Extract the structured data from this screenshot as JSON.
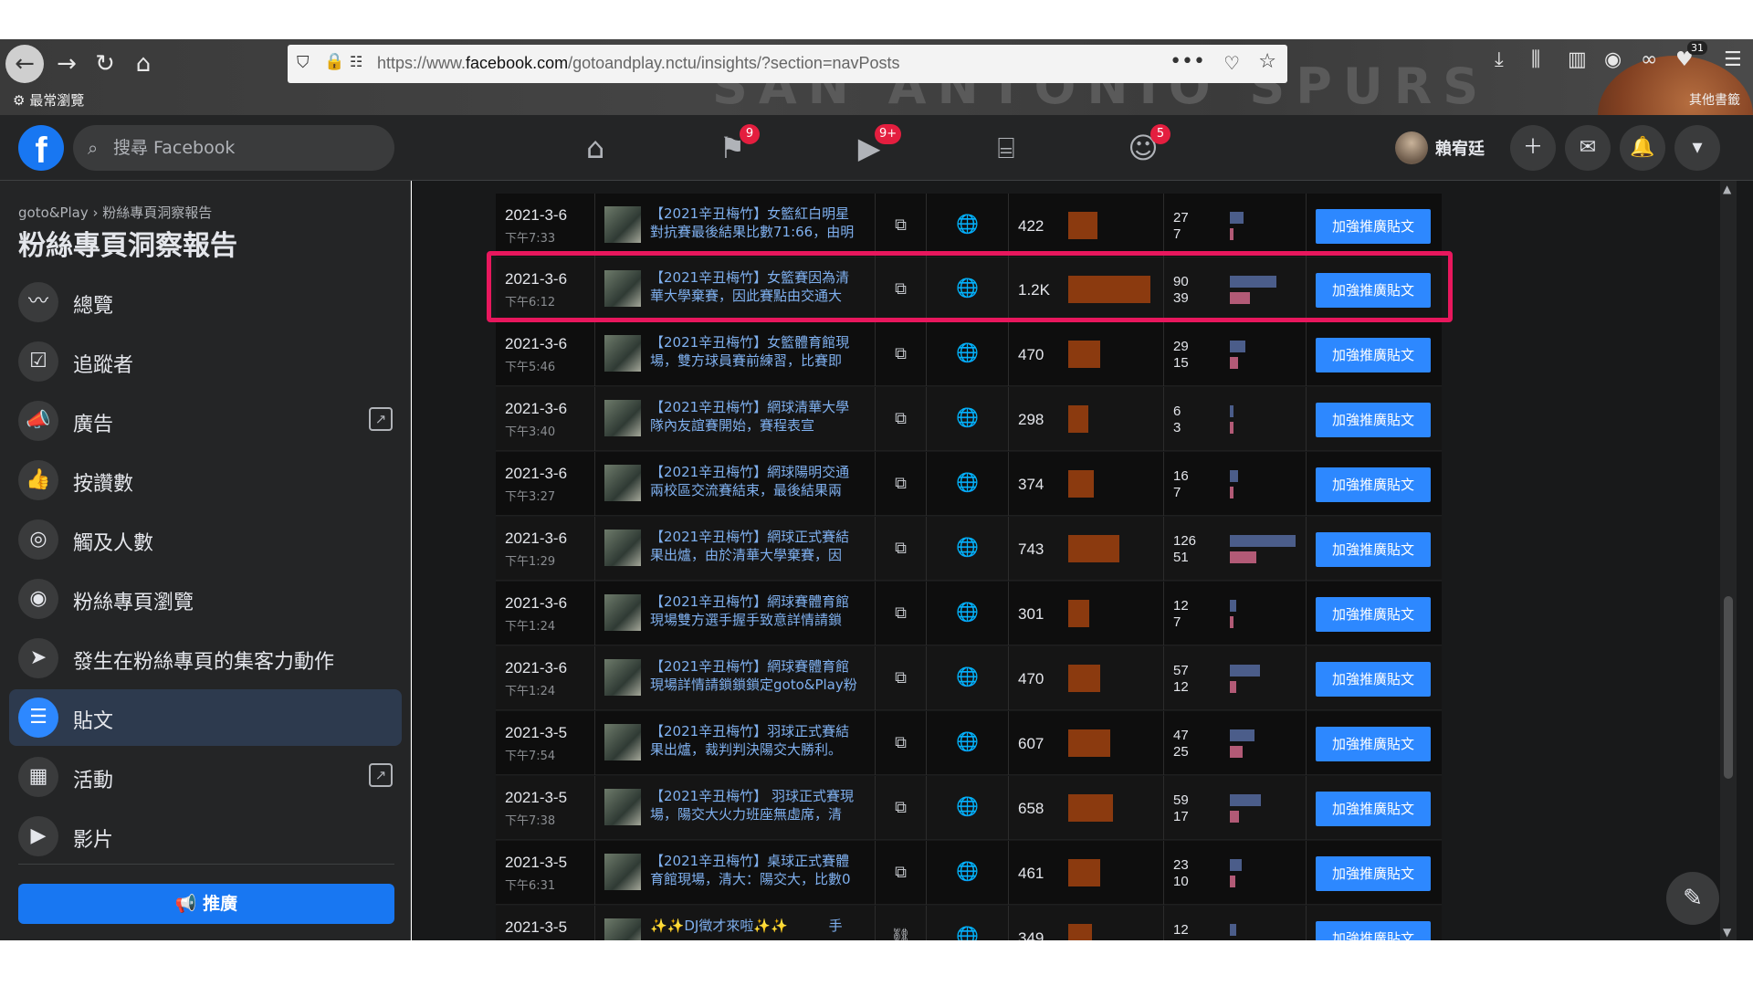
{
  "browser": {
    "url_prefix": "https://www.",
    "url_domain": "facebook.com",
    "url_path": "/gotoandplay.nctu/insights/?section=navPosts",
    "bookmark_label": "最常瀏覽",
    "other_bookmarks": "其他書籤",
    "download_badge": "31",
    "theme_watermark": "SAN ANTONIO SPURS"
  },
  "fb_header": {
    "search_placeholder": "搜尋 Facebook",
    "badges": {
      "flag": "9",
      "watch": "9+",
      "groups": "5"
    },
    "profile_name": "賴宥廷"
  },
  "sidebar": {
    "breadcrumb": "goto&Play › 粉絲專頁洞察報告",
    "title": "粉絲專頁洞察報告",
    "items": [
      {
        "label": "總覽"
      },
      {
        "label": "追蹤者"
      },
      {
        "label": "廣告"
      },
      {
        "label": "按讚數"
      },
      {
        "label": "觸及人數"
      },
      {
        "label": "粉絲專頁瀏覽"
      },
      {
        "label": "發生在粉絲專頁的集客力動作"
      },
      {
        "label": "貼文"
      },
      {
        "label": "活動"
      },
      {
        "label": "影片"
      }
    ],
    "promote_label": "推廣"
  },
  "posts": {
    "boost_label": "加強推廣貼文",
    "rows": [
      {
        "date": "2021-3-6",
        "time": "下午7:33",
        "line1": "【2021辛丑梅竹】女籃紅白明星",
        "line2": "對抗賽最後結果比數71:66，由明",
        "reach": "422",
        "reach_value": 422,
        "eng1": "27",
        "eng2": "7"
      },
      {
        "date": "2021-3-6",
        "time": "下午6:12",
        "line1": "【2021辛丑梅竹】女籃賽因為清",
        "line2": "華大學棄賽，因此賽點由交通大",
        "reach": "1.2K",
        "reach_value": 1200,
        "eng1": "90",
        "eng2": "39"
      },
      {
        "date": "2021-3-6",
        "time": "下午5:46",
        "line1": "【2021辛丑梅竹】女籃體育館現",
        "line2": "場，雙方球員賽前練習，比賽即",
        "reach": "470",
        "reach_value": 470,
        "eng1": "29",
        "eng2": "15"
      },
      {
        "date": "2021-3-6",
        "time": "下午3:40",
        "line1": "【2021辛丑梅竹】網球清華大學",
        "line2": "隊內友誼賽開始，賽程表宣",
        "reach": "298",
        "reach_value": 298,
        "eng1": "6",
        "eng2": "3"
      },
      {
        "date": "2021-3-6",
        "time": "下午3:27",
        "line1": "【2021辛丑梅竹】網球陽明交通",
        "line2": "兩校區交流賽結束，最後結果兩",
        "reach": "374",
        "reach_value": 374,
        "eng1": "16",
        "eng2": "7"
      },
      {
        "date": "2021-3-6",
        "time": "下午1:29",
        "line1": "【2021辛丑梅竹】網球正式賽結",
        "line2": "果出爐，由於清華大學棄賽，因",
        "reach": "743",
        "reach_value": 743,
        "eng1": "126",
        "eng2": "51"
      },
      {
        "date": "2021-3-6",
        "time": "下午1:24",
        "line1": "【2021辛丑梅竹】網球賽體育館",
        "line2": "現場雙方選手握手致意詳情請鎖",
        "reach": "301",
        "reach_value": 301,
        "eng1": "12",
        "eng2": "7"
      },
      {
        "date": "2021-3-6",
        "time": "下午1:24",
        "line1": "【2021辛丑梅竹】網球賽體育館",
        "line2": "現場詳情請鎖鎖鎖定goto&Play粉",
        "reach": "470",
        "reach_value": 470,
        "eng1": "57",
        "eng2": "12"
      },
      {
        "date": "2021-3-5",
        "time": "下午7:54",
        "line1": "【2021辛丑梅竹】羽球正式賽結",
        "line2": "果出爐，裁判判決陽交大勝利。",
        "reach": "607",
        "reach_value": 607,
        "eng1": "47",
        "eng2": "25"
      },
      {
        "date": "2021-3-5",
        "time": "下午7:38",
        "line1": "【2021辛丑梅竹】 羽球正式賽現",
        "line2": "場，陽交大火力班座無虛席，清",
        "reach": "658",
        "reach_value": 658,
        "eng1": "59",
        "eng2": "17"
      },
      {
        "date": "2021-3-5",
        "time": "下午6:31",
        "line1": "【2021辛丑梅竹】桌球正式賽體",
        "line2": "育館現場，清大：陽交大，比數0",
        "reach": "461",
        "reach_value": 461,
        "eng1": "23",
        "eng2": "10"
      },
      {
        "date": "2021-3-5",
        "time": "",
        "line1": "✨✨DJ徵才來啦✨✨　　　手",
        "line2": "",
        "reach": "349",
        "reach_value": 349,
        "eng1": "12",
        "eng2": ""
      }
    ]
  },
  "colors": {
    "fb_blue": "#1877f2",
    "highlight": "#e8175d",
    "reach_bar": "#8b3a0f"
  }
}
